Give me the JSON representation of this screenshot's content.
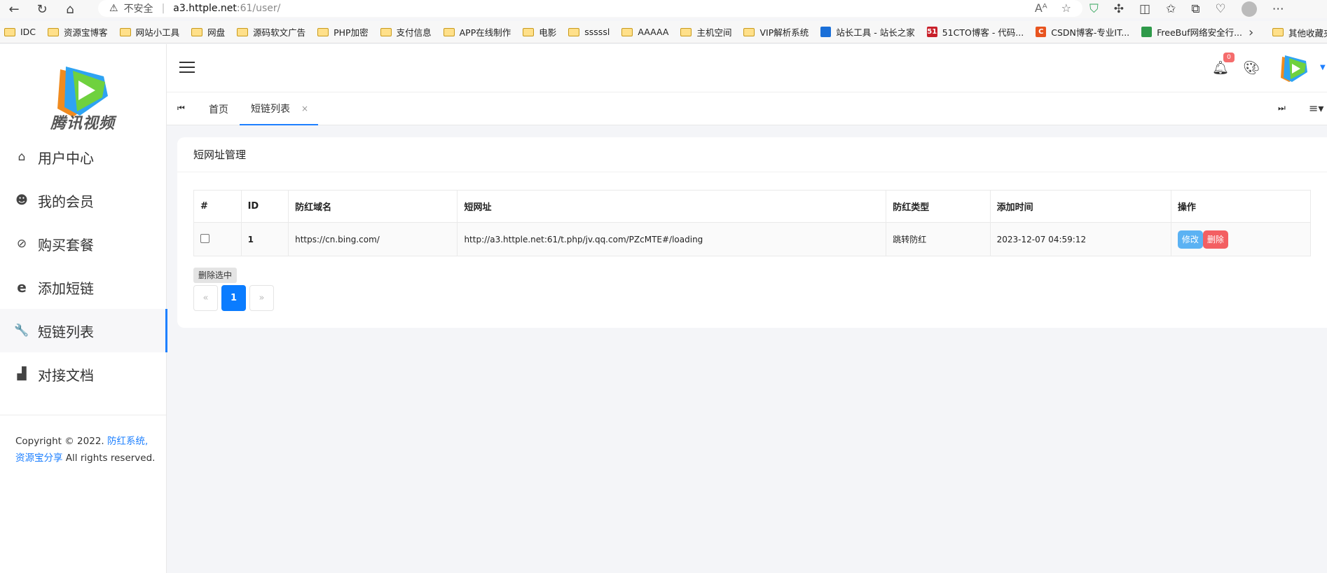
{
  "browser": {
    "security_label": "不安全",
    "url_host": "a3.httple.net",
    "url_path": ":61/user/",
    "bookmarks": [
      {
        "label": "IDC",
        "type": "folder"
      },
      {
        "label": "资源宝博客",
        "type": "folder"
      },
      {
        "label": "网站小工具",
        "type": "folder"
      },
      {
        "label": "网盘",
        "type": "folder"
      },
      {
        "label": "源码软文广告",
        "type": "folder"
      },
      {
        "label": "PHP加密",
        "type": "folder"
      },
      {
        "label": "支付信息",
        "type": "folder"
      },
      {
        "label": "APP在线制作",
        "type": "folder"
      },
      {
        "label": "电影",
        "type": "folder"
      },
      {
        "label": "sssssl",
        "type": "folder"
      },
      {
        "label": "AAAAA",
        "type": "folder"
      },
      {
        "label": "主机空间",
        "type": "folder"
      },
      {
        "label": "VIP解析系统",
        "type": "folder"
      },
      {
        "label": "站长工具 - 站长之家",
        "type": "site",
        "color": "#1a6fd8",
        "glyph": ""
      },
      {
        "label": "51CTO博客 - 代码...",
        "type": "site",
        "color": "#c8202a",
        "glyph": "51"
      },
      {
        "label": "CSDN博客-专业IT...",
        "type": "site",
        "color": "#e8541f",
        "glyph": "C"
      },
      {
        "label": "FreeBuf网络安全行...",
        "type": "site",
        "color": "#2f9a4a",
        "glyph": ""
      }
    ],
    "other_bookmarks": "其他收藏夹"
  },
  "sidebar": {
    "logo_text": "腾讯视频",
    "items": [
      {
        "label": "用户中心",
        "icon": "home-icon",
        "glyph": "⌂"
      },
      {
        "label": "我的会员",
        "icon": "face-icon",
        "glyph": "☻"
      },
      {
        "label": "购买套餐",
        "icon": "compass-icon",
        "glyph": "⊘"
      },
      {
        "label": "添加短链",
        "icon": "edge-icon",
        "glyph": "e"
      },
      {
        "label": "短链列表",
        "icon": "wrench-icon",
        "glyph": "🔧"
      },
      {
        "label": "对接文档",
        "icon": "bar-chart-icon",
        "glyph": "▟"
      }
    ],
    "copyright_prefix": "Copyright © 2022. ",
    "copyright_link1": "防红系统,",
    "copyright_link2": "资源宝分享",
    "copyright_suffix": " All rights reserved."
  },
  "header": {
    "notification_count": "0"
  },
  "tabs": {
    "home": "首页",
    "active": "短链列表",
    "close_glyph": "×"
  },
  "card": {
    "title": "短网址管理",
    "columns": [
      "#",
      "ID",
      "防红域名",
      "短网址",
      "防红类型",
      "添加时间",
      "操作"
    ],
    "rows": [
      {
        "id": "1",
        "domain": "https://cn.bing.com/",
        "short_url": "http://a3.httple.net:61/t.php/jv.qq.com/PZcMTE#/loading",
        "type": "跳转防红",
        "time": "2023-12-07 04:59:12",
        "edit_label": "修改",
        "delete_label": "删除"
      }
    ],
    "delete_selected": "删除选中",
    "pager": {
      "prev": "«",
      "current": "1",
      "next": "»"
    }
  }
}
